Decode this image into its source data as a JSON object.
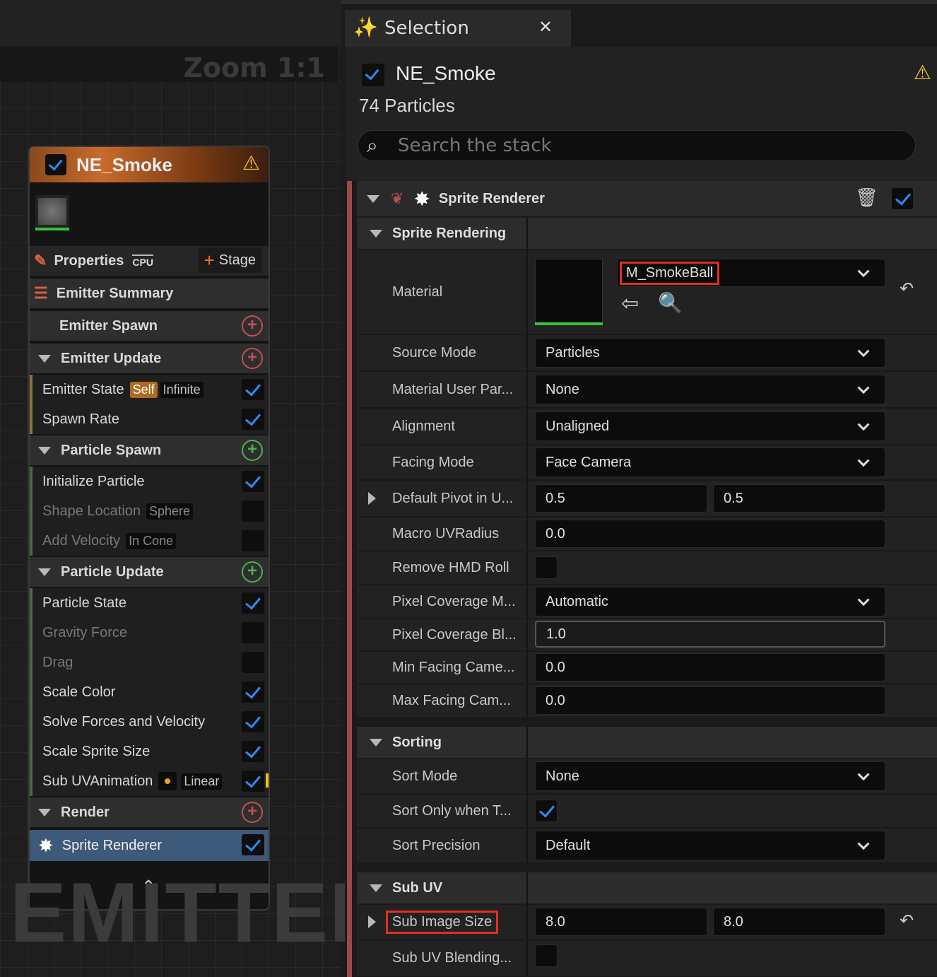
{
  "graph": {
    "zoom": "Zoom 1:1",
    "watermark": "EMITTER"
  },
  "node": {
    "title": "NE_Smoke",
    "properties_label": "Properties",
    "cpu_label": "CPU",
    "stage_label": "Stage",
    "emitter_summary": "Emitter Summary",
    "rows": [
      {
        "label": "Emitter Spawn"
      },
      {
        "label": "Emitter Update"
      },
      {
        "label": "Emitter State",
        "tag1": "Self",
        "tag2": "Infinite"
      },
      {
        "label": "Spawn Rate"
      },
      {
        "label": "Particle Spawn"
      },
      {
        "label": "Initialize Particle"
      },
      {
        "label": "Shape Location",
        "tag1": "Sphere"
      },
      {
        "label": "Add Velocity",
        "tag1": "In Cone"
      },
      {
        "label": "Particle Update"
      },
      {
        "label": "Particle State"
      },
      {
        "label": "Gravity Force"
      },
      {
        "label": "Drag"
      },
      {
        "label": "Scale Color"
      },
      {
        "label": "Solve Forces and Velocity"
      },
      {
        "label": "Scale Sprite Size"
      },
      {
        "label": "Sub UVAnimation",
        "tag1": "Linear"
      },
      {
        "label": "Render"
      },
      {
        "label": "Sprite Renderer"
      }
    ]
  },
  "panel": {
    "tab_title": "Selection",
    "emitter_name": "NE_Smoke",
    "particles": "74 Particles",
    "search_placeholder": "Search the stack",
    "renderer_title": "Sprite Renderer",
    "sections": {
      "sprite_rendering": "Sprite Rendering",
      "sorting": "Sorting",
      "sub_uv": "Sub UV"
    },
    "props": {
      "material": {
        "name": "Material",
        "value": "M_SmokeBall"
      },
      "source_mode": {
        "name": "Source Mode",
        "value": "Particles"
      },
      "material_user_par": {
        "name": "Material User Par...",
        "value": "None"
      },
      "alignment": {
        "name": "Alignment",
        "value": "Unaligned"
      },
      "facing_mode": {
        "name": "Facing Mode",
        "value": "Face Camera"
      },
      "default_pivot": {
        "name": "Default Pivot in U...",
        "x": "0.5",
        "y": "0.5"
      },
      "macro_uv": {
        "name": "Macro UVRadius",
        "value": "0.0"
      },
      "remove_hmd": {
        "name": "Remove HMD Roll"
      },
      "pixel_cov_m": {
        "name": "Pixel Coverage M...",
        "value": "Automatic"
      },
      "pixel_cov_bl": {
        "name": "Pixel Coverage Bl...",
        "value": "1.0"
      },
      "min_facing": {
        "name": "Min Facing Came...",
        "value": "0.0"
      },
      "max_facing": {
        "name": "Max Facing Cam...",
        "value": "0.0"
      },
      "sort_mode": {
        "name": "Sort Mode",
        "value": "None"
      },
      "sort_only": {
        "name": "Sort Only when T..."
      },
      "sort_precision": {
        "name": "Sort Precision",
        "value": "Default"
      },
      "sub_image_size": {
        "name": "Sub Image Size",
        "x": "8.0",
        "y": "8.0"
      },
      "sub_uv_blending": {
        "name": "Sub UV Blending..."
      }
    }
  }
}
